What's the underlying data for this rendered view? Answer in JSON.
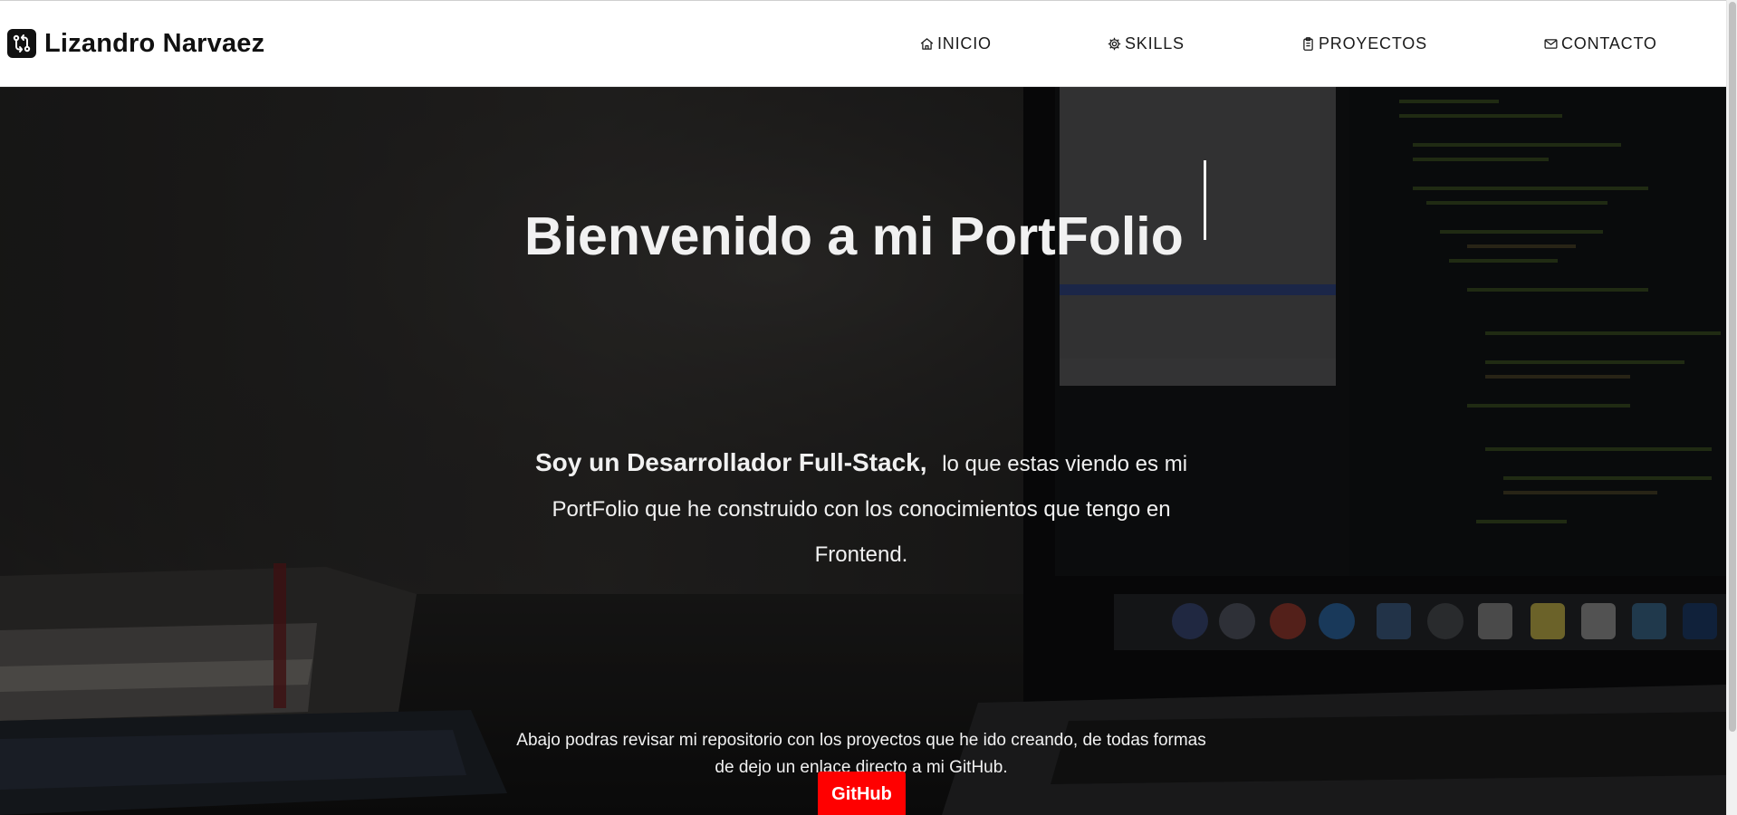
{
  "header": {
    "brand_name": "Lizandro Narvaez",
    "brand_icon": "git-compare-icon",
    "nav": [
      {
        "label": "INICIO",
        "icon": "home-icon"
      },
      {
        "label": "SKILLS",
        "icon": "gear-icon"
      },
      {
        "label": "PROYECTOS",
        "icon": "clipboard-icon"
      },
      {
        "label": "CONTACTO",
        "icon": "mail-icon"
      }
    ]
  },
  "hero": {
    "title": "Bienvenido a mi PortFolio",
    "intro_bold": "Soy un Desarrollador Full-Stack,",
    "intro_rest": "lo que estas viendo es mi PortFolio que he construido con los conocimientos que tengo en Frontend.",
    "repo_text": "Abajo podras revisar mi repositorio con los proyectos que he ido creando, de todas formas de dejo un enlace directo a mi GitHub.",
    "github_label": "GitHub"
  },
  "colors": {
    "accent_button": "#ff0000",
    "hero_text": "#f1f1f1",
    "nav_text": "#1a1a1a"
  }
}
